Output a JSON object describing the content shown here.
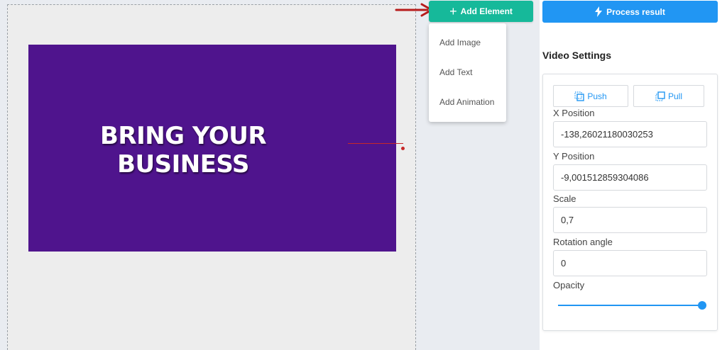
{
  "canvas": {
    "slide_text": "BRING YOUR BUSINESS",
    "slide_color": "#4f148d"
  },
  "toolbar": {
    "add_element_label": "Add Element",
    "add_element_icon": "plus-icon",
    "add_element_color": "#16b99a",
    "process_label": "Process result",
    "process_icon": "lightning-icon",
    "process_color": "#2196f3"
  },
  "add_menu": {
    "items": [
      {
        "label": "Add Image"
      },
      {
        "label": "Add Text"
      },
      {
        "label": "Add Animation"
      }
    ]
  },
  "settings": {
    "title": "Video Settings",
    "push_label": "Push",
    "pull_label": "Pull",
    "fields": {
      "x_position": {
        "label": "X Position",
        "value": "-138,26021180030253"
      },
      "y_position": {
        "label": "Y Position",
        "value": "-9,001512859304086"
      },
      "scale": {
        "label": "Scale",
        "value": "0,7"
      },
      "rotation": {
        "label": "Rotation angle",
        "value": "0"
      }
    },
    "opacity": {
      "label": "Opacity",
      "value": 1.0
    }
  }
}
